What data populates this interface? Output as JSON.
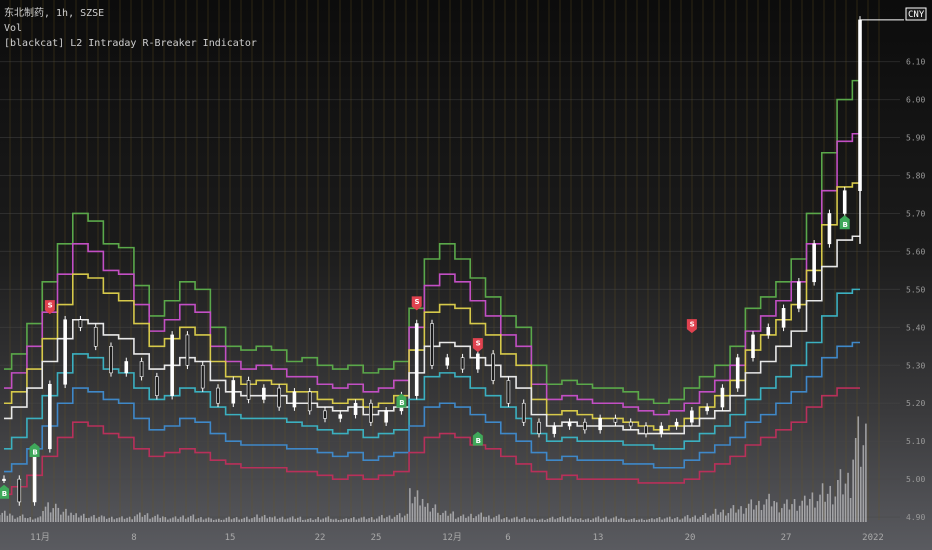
{
  "legend": {
    "line1": "东北制药, 1h, SZSE",
    "line2": "Vol",
    "line3": "[blackcat] L2 Intraday R-Breaker Indicator"
  },
  "currency": "CNY",
  "chart_data": {
    "type": "line",
    "title": "东北制药, 1h, SZSE",
    "y_ticks": [
      "6.10",
      "6.00",
      "5.90",
      "5.80",
      "5.70",
      "5.60",
      "5.50",
      "5.40",
      "5.30",
      "5.20",
      "5.10",
      "5.00",
      "4.90"
    ],
    "y_range": [
      4.895,
      6.215
    ],
    "x_ticks": [
      "11月",
      "8",
      "15",
      "22",
      "25",
      "12月",
      "6",
      "13",
      "20",
      "27",
      "2022"
    ],
    "series": [
      {
        "key": "green",
        "color": "#5aa84a",
        "values": [
          5.29,
          5.33,
          5.41,
          5.52,
          5.62,
          5.7,
          5.68,
          5.62,
          5.61,
          5.51,
          5.43,
          5.47,
          5.52,
          5.5,
          5.4,
          5.35,
          5.34,
          5.35,
          5.34,
          5.31,
          5.32,
          5.3,
          5.29,
          5.3,
          5.28,
          5.29,
          5.31,
          5.45,
          5.58,
          5.62,
          5.58,
          5.53,
          5.48,
          5.43,
          5.4,
          5.3,
          5.25,
          5.26,
          5.25,
          5.24,
          5.24,
          5.23,
          5.21,
          5.2,
          5.21,
          5.24,
          5.27,
          5.3,
          5.35,
          5.45,
          5.48,
          5.52,
          5.58,
          5.7,
          5.86,
          6.0,
          6.05
        ]
      },
      {
        "key": "magenta",
        "color": "#c24fc4",
        "values": [
          5.24,
          5.28,
          5.35,
          5.44,
          5.54,
          5.62,
          5.6,
          5.55,
          5.54,
          5.46,
          5.39,
          5.42,
          5.46,
          5.44,
          5.35,
          5.31,
          5.29,
          5.3,
          5.29,
          5.27,
          5.27,
          5.25,
          5.24,
          5.25,
          5.23,
          5.24,
          5.26,
          5.4,
          5.51,
          5.54,
          5.52,
          5.47,
          5.43,
          5.38,
          5.35,
          5.25,
          5.21,
          5.22,
          5.21,
          5.2,
          5.2,
          5.19,
          5.18,
          5.17,
          5.18,
          5.2,
          5.23,
          5.26,
          5.3,
          5.39,
          5.43,
          5.47,
          5.52,
          5.62,
          5.76,
          5.89,
          5.91
        ]
      },
      {
        "key": "yellow",
        "color": "#d6c94a",
        "values": [
          5.2,
          5.23,
          5.29,
          5.37,
          5.46,
          5.54,
          5.53,
          5.49,
          5.47,
          5.41,
          5.35,
          5.37,
          5.4,
          5.38,
          5.31,
          5.27,
          5.25,
          5.26,
          5.25,
          5.23,
          5.23,
          5.21,
          5.2,
          5.21,
          5.19,
          5.2,
          5.22,
          5.34,
          5.44,
          5.46,
          5.45,
          5.41,
          5.38,
          5.33,
          5.3,
          5.21,
          5.17,
          5.18,
          5.17,
          5.16,
          5.16,
          5.15,
          5.14,
          5.13,
          5.14,
          5.16,
          5.19,
          5.22,
          5.26,
          5.34,
          5.38,
          5.42,
          5.46,
          5.55,
          5.67,
          5.77,
          5.78
        ]
      },
      {
        "key": "white",
        "color": "#e8e8e8",
        "values": [
          5.16,
          5.19,
          5.24,
          5.31,
          5.37,
          5.42,
          5.41,
          5.38,
          5.37,
          5.33,
          5.29,
          5.3,
          5.32,
          5.31,
          5.26,
          5.23,
          5.22,
          5.22,
          5.22,
          5.2,
          5.2,
          5.19,
          5.18,
          5.19,
          5.17,
          5.18,
          5.19,
          5.28,
          5.35,
          5.36,
          5.35,
          5.32,
          5.3,
          5.27,
          5.24,
          5.17,
          5.14,
          5.15,
          5.14,
          5.14,
          5.14,
          5.13,
          5.12,
          5.12,
          5.12,
          5.14,
          5.16,
          5.18,
          5.22,
          5.28,
          5.31,
          5.35,
          5.39,
          5.47,
          5.56,
          5.63,
          5.64
        ]
      },
      {
        "key": "teal",
        "color": "#3bb0c0",
        "values": [
          5.08,
          5.11,
          5.16,
          5.22,
          5.28,
          5.33,
          5.32,
          5.29,
          5.28,
          5.24,
          5.21,
          5.22,
          5.24,
          5.23,
          5.19,
          5.17,
          5.16,
          5.16,
          5.16,
          5.15,
          5.14,
          5.13,
          5.12,
          5.13,
          5.11,
          5.12,
          5.13,
          5.21,
          5.27,
          5.28,
          5.27,
          5.24,
          5.22,
          5.19,
          5.16,
          5.12,
          5.1,
          5.11,
          5.1,
          5.1,
          5.1,
          5.09,
          5.09,
          5.08,
          5.08,
          5.1,
          5.12,
          5.14,
          5.17,
          5.21,
          5.24,
          5.27,
          5.3,
          5.36,
          5.43,
          5.49,
          5.5
        ]
      },
      {
        "key": "blue",
        "color": "#3f88c8",
        "values": [
          5.02,
          5.04,
          5.08,
          5.14,
          5.2,
          5.24,
          5.23,
          5.21,
          5.2,
          5.16,
          5.13,
          5.14,
          5.16,
          5.15,
          5.12,
          5.1,
          5.09,
          5.09,
          5.09,
          5.08,
          5.08,
          5.07,
          5.06,
          5.07,
          5.05,
          5.06,
          5.07,
          5.14,
          5.19,
          5.2,
          5.19,
          5.17,
          5.15,
          5.12,
          5.1,
          5.07,
          5.05,
          5.06,
          5.05,
          5.05,
          5.05,
          5.04,
          5.04,
          5.03,
          5.03,
          5.05,
          5.07,
          5.09,
          5.11,
          5.15,
          5.17,
          5.2,
          5.23,
          5.27,
          5.32,
          5.35,
          5.36
        ]
      },
      {
        "key": "crimson",
        "color": "#b8305a",
        "values": [
          4.96,
          4.98,
          5.01,
          5.06,
          5.11,
          5.15,
          5.14,
          5.12,
          5.11,
          5.08,
          5.06,
          5.07,
          5.08,
          5.07,
          5.05,
          5.04,
          5.03,
          5.03,
          5.03,
          5.02,
          5.02,
          5.01,
          5.0,
          5.01,
          5.0,
          5.01,
          5.02,
          5.07,
          5.11,
          5.12,
          5.11,
          5.09,
          5.08,
          5.06,
          5.04,
          5.02,
          5.0,
          5.01,
          5.0,
          5.0,
          5.0,
          5.0,
          4.99,
          4.99,
          4.99,
          5.0,
          5.02,
          5.04,
          5.06,
          5.09,
          5.11,
          5.13,
          5.15,
          5.19,
          5.22,
          5.24,
          5.24
        ]
      },
      {
        "key": "price",
        "color": "#ffffff",
        "values": [
          5.0,
          4.94,
          5.08,
          5.25,
          5.42,
          5.4,
          5.35,
          5.28,
          5.31,
          5.27,
          5.22,
          5.38,
          5.3,
          5.24,
          5.2,
          5.26,
          5.21,
          5.24,
          5.19,
          5.23,
          5.18,
          5.16,
          5.17,
          5.2,
          5.15,
          5.18,
          5.22,
          5.41,
          5.3,
          5.32,
          5.29,
          5.33,
          5.26,
          5.2,
          5.15,
          5.12,
          5.14,
          5.15,
          5.13,
          5.16,
          5.15,
          5.14,
          5.12,
          5.14,
          5.15,
          5.18,
          5.19,
          5.24,
          5.32,
          5.38,
          5.4,
          5.45,
          5.52,
          5.62,
          5.7,
          5.76,
          6.21
        ]
      }
    ],
    "signals": [
      {
        "label": "B",
        "kind": "buy",
        "i": 0,
        "y": 4.98
      },
      {
        "label": "B",
        "kind": "buy",
        "i": 2,
        "y": 5.09
      },
      {
        "label": "S",
        "kind": "sell",
        "i": 3,
        "y": 5.44
      },
      {
        "label": "S",
        "kind": "sell",
        "i": 27,
        "y": 5.45
      },
      {
        "label": "B",
        "kind": "buy",
        "i": 26,
        "y": 5.22
      },
      {
        "label": "S",
        "kind": "sell",
        "i": 31,
        "y": 5.34
      },
      {
        "label": "B",
        "kind": "buy",
        "i": 31,
        "y": 5.12
      },
      {
        "label": "S",
        "kind": "sell",
        "i": 45,
        "y": 5.39
      },
      {
        "label": "B",
        "kind": "buy",
        "i": 55,
        "y": 5.69
      }
    ],
    "volume": [
      6,
      4,
      3,
      12,
      8,
      5,
      4,
      3,
      3,
      5,
      4,
      3,
      4,
      3,
      2,
      3,
      3,
      4,
      3,
      3,
      2,
      3,
      2,
      3,
      3,
      4,
      5,
      18,
      10,
      6,
      4,
      5,
      4,
      3,
      3,
      2,
      3,
      3,
      2,
      3,
      3,
      2,
      2,
      3,
      3,
      4,
      5,
      7,
      9,
      12,
      15,
      12,
      14,
      18,
      22,
      30,
      60
    ]
  }
}
